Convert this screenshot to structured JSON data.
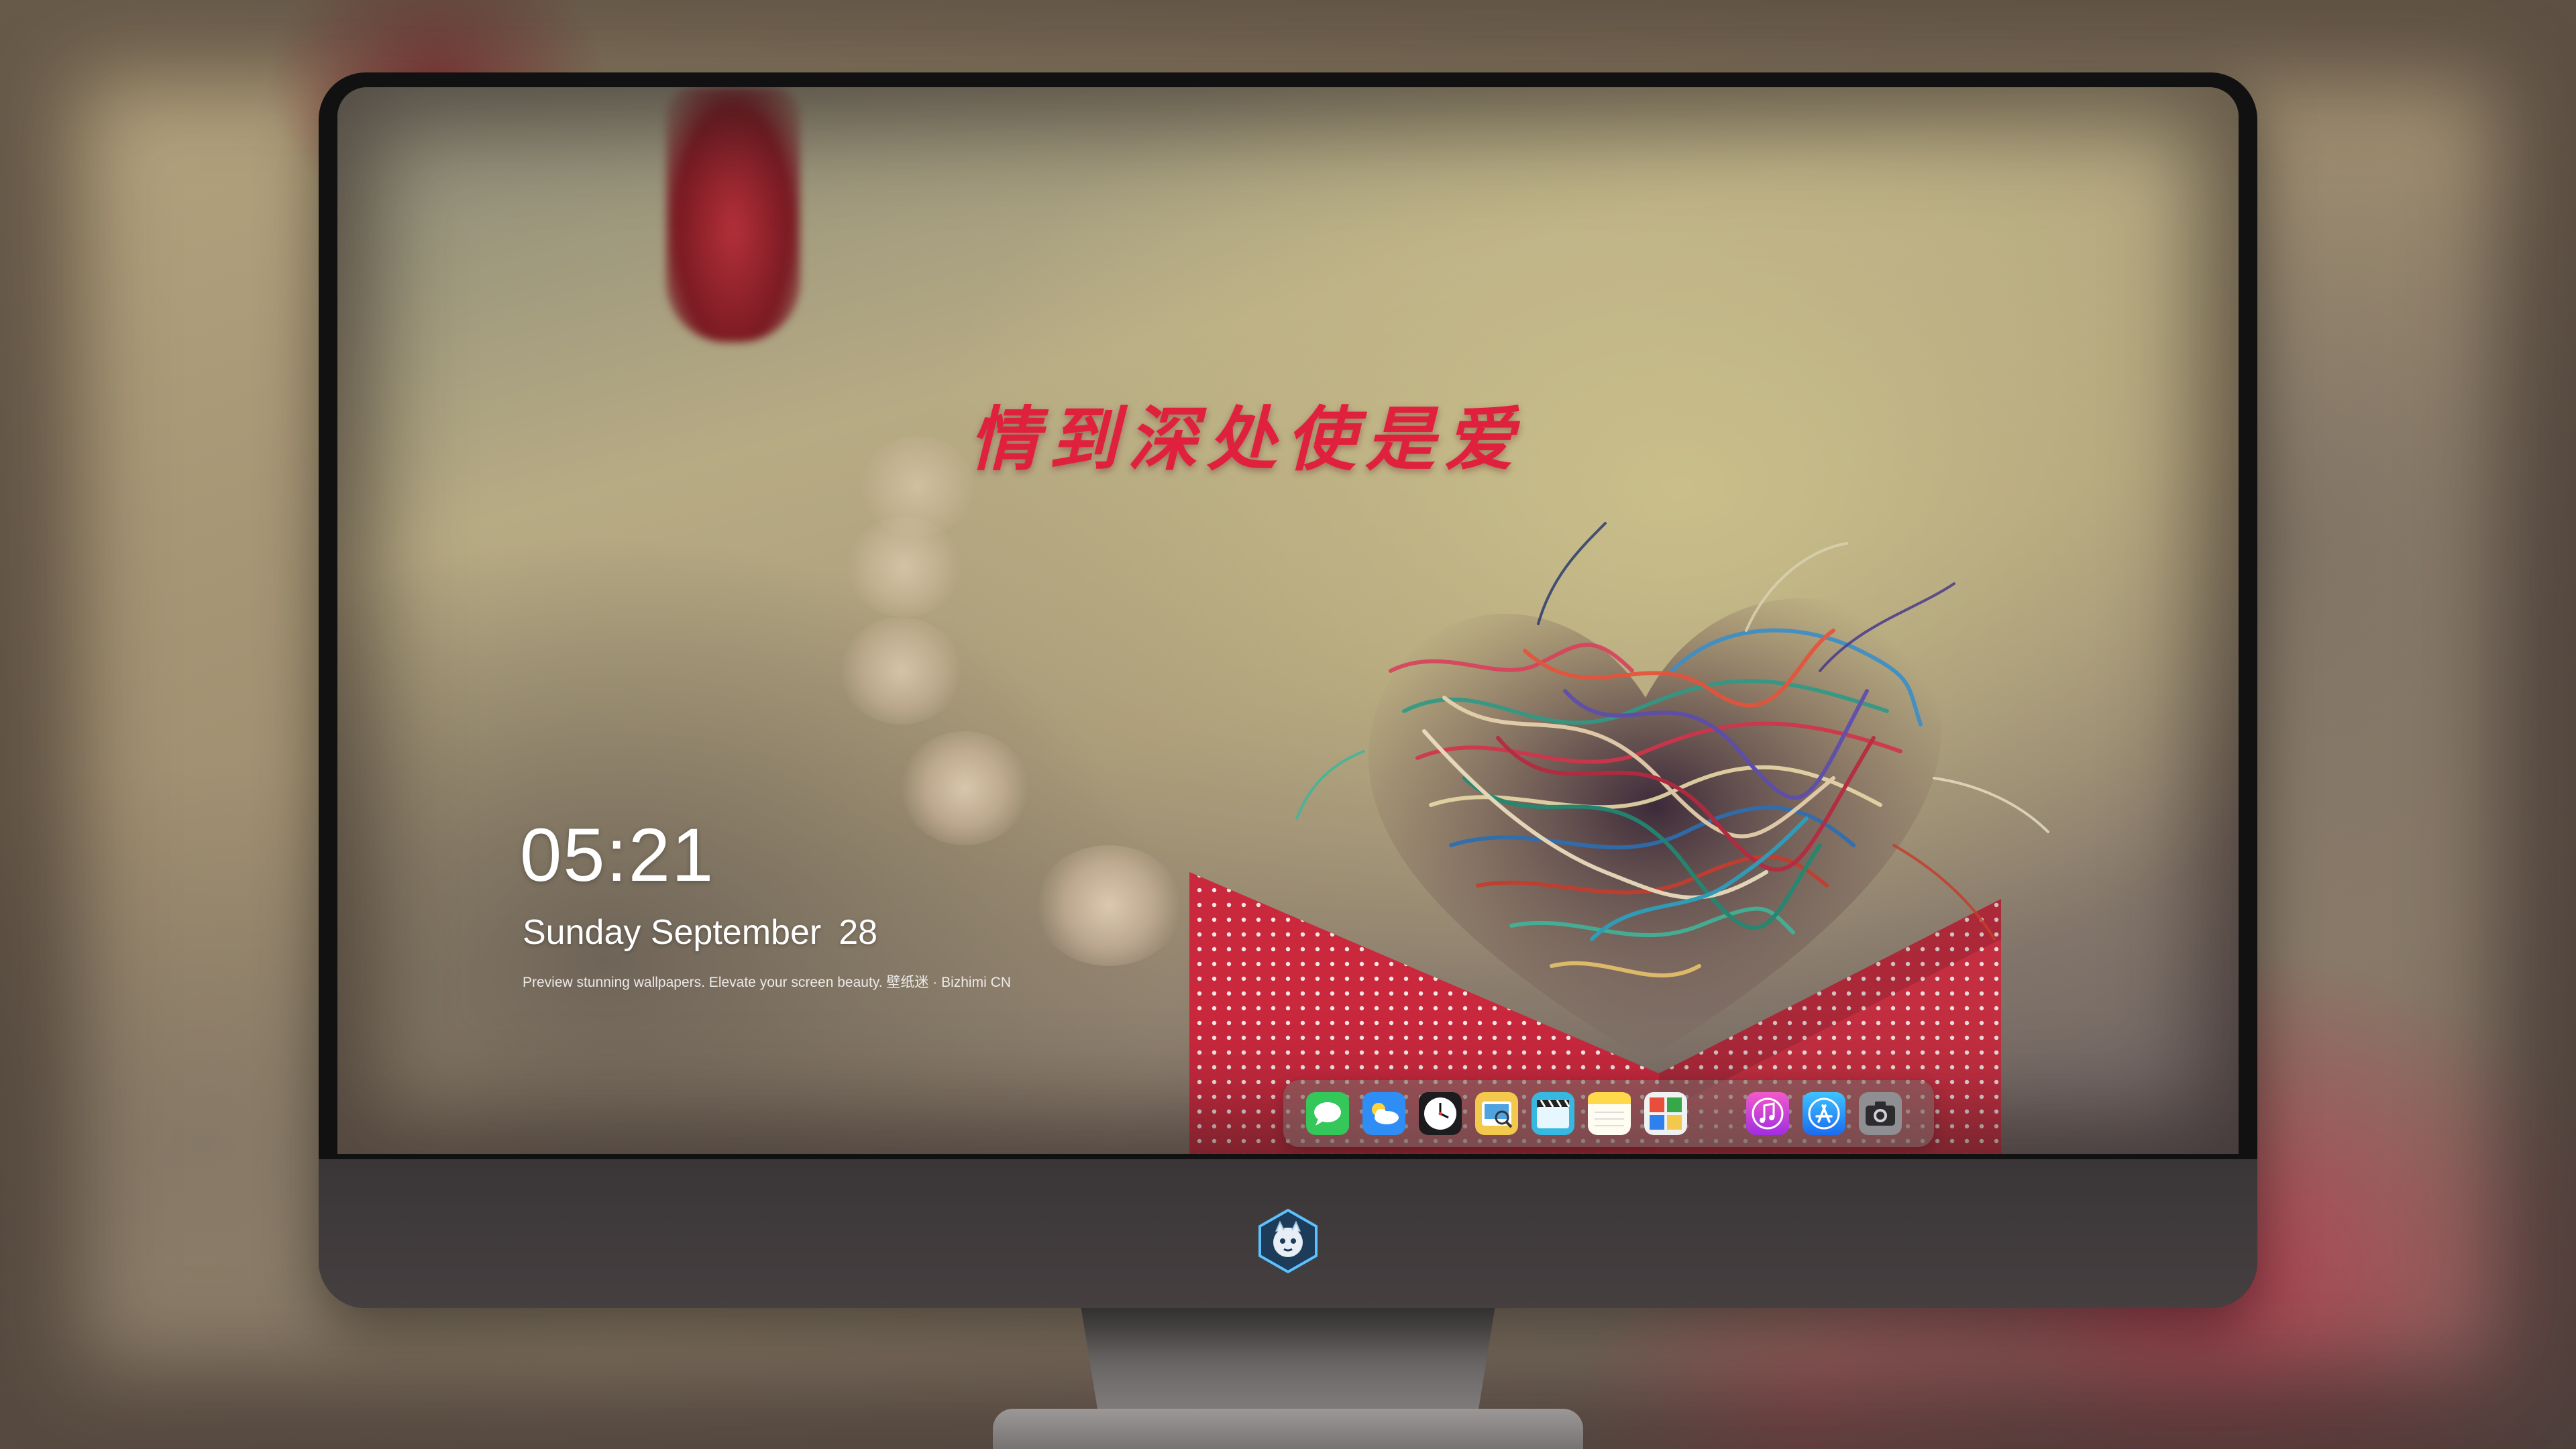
{
  "wallpaper": {
    "headline": "情到深处使是爱"
  },
  "lock_screen": {
    "time": "05:21",
    "weekday": "Sunday",
    "month": "September",
    "day": "28",
    "tagline": "Preview stunning wallpapers. Elevate your screen beauty. 壁纸迷 · Bizhimi CN"
  },
  "dock": {
    "apps": [
      {
        "name": "messages-icon",
        "color": "#34c759"
      },
      {
        "name": "weather-icon",
        "color": "#2f8ef5"
      },
      {
        "name": "clock-icon",
        "color": "#1c1c1e"
      },
      {
        "name": "preview-icon",
        "color": "#f2c94c"
      },
      {
        "name": "clips-icon",
        "color": "#36b8e0"
      },
      {
        "name": "notes-icon",
        "color": "#ffd94a"
      },
      {
        "name": "photo-booth-icon",
        "color": "#e94e3c"
      },
      {
        "name": "music-icon",
        "color": "#d63dd1"
      },
      {
        "name": "app-store-icon",
        "color": "#1a8cff"
      },
      {
        "name": "camera-icon",
        "color": "#8e8e93"
      }
    ]
  },
  "monitor": {
    "logo": "mascot-logo-icon"
  }
}
